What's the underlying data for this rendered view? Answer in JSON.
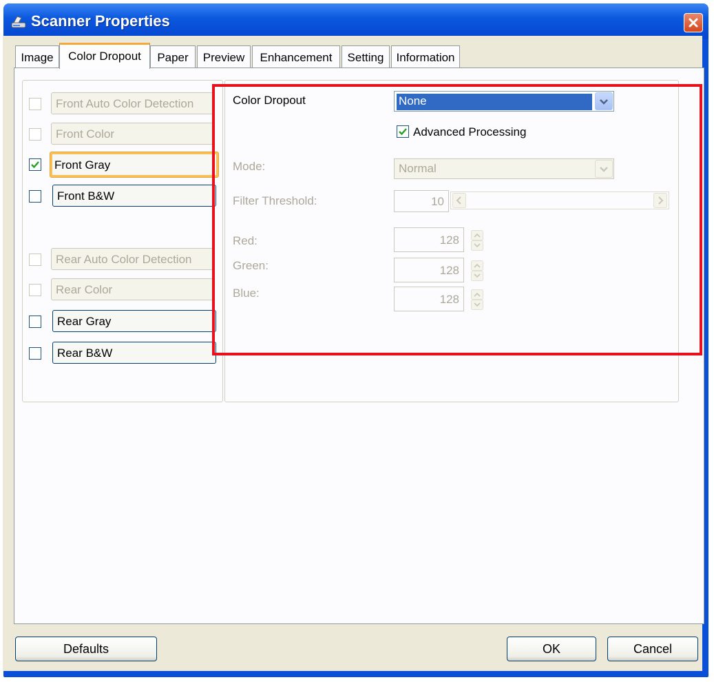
{
  "window": {
    "title": "Scanner Properties"
  },
  "tabs": [
    "Image",
    "Color Dropout",
    "Paper",
    "Preview",
    "Enhancement",
    "Setting",
    "Information"
  ],
  "active_tab": "Color Dropout",
  "left_items": {
    "front_auto": "Front Auto Color Detection",
    "front_color": "Front Color",
    "front_gray": "Front Gray",
    "front_bw": "Front B&W",
    "rear_auto": "Rear Auto Color Detection",
    "rear_color": "Rear Color",
    "rear_gray": "Rear Gray",
    "rear_bw": "Rear B&W"
  },
  "right": {
    "color_dropout_label": "Color Dropout",
    "color_dropout_value": "None",
    "advanced_processing": "Advanced Processing",
    "mode_label": "Mode:",
    "mode_value": "Normal",
    "filter_label": "Filter Threshold:",
    "filter_value": "10",
    "red_label": "Red:",
    "red_value": "128",
    "green_label": "Green:",
    "green_value": "128",
    "blue_label": "Blue:",
    "blue_value": "128"
  },
  "buttons": {
    "defaults": "Defaults",
    "ok": "OK",
    "cancel": "Cancel"
  },
  "colors": {
    "titlebar": "#0b58de",
    "highlight": "#316ac5",
    "annotation_box": "#e8101a",
    "tab_accent": "#f4a93a"
  }
}
